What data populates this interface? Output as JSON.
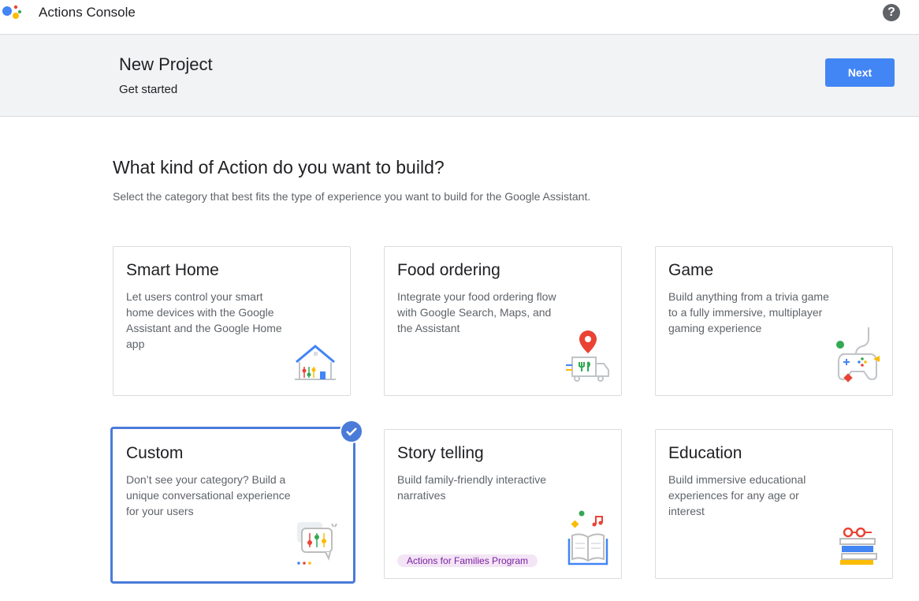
{
  "app": {
    "title": "Actions Console",
    "logo_icon": "google-assistant-logo-icon",
    "help_icon": "help-icon",
    "logo_colors": [
      "#4285f4",
      "#ea4335",
      "#fbbc05",
      "#34a853"
    ]
  },
  "header": {
    "title": "New Project",
    "subtitle": "Get started",
    "next_label": "Next"
  },
  "main": {
    "heading": "What kind of Action do you want to build?",
    "subheading": "Select the category that best fits the type of experience you want to build for the Google Assistant."
  },
  "cards": [
    {
      "title": "Smart Home",
      "description": "Let users control your smart home devices with the Google Assistant and the Google Home app",
      "icon": "smart-home-icon",
      "selected": false
    },
    {
      "title": "Food ordering",
      "description": "Integrate your food ordering flow with Google Search, Maps, and the Assistant",
      "icon": "food-truck-icon",
      "selected": false
    },
    {
      "title": "Game",
      "description": "Build anything from a trivia game to a fully immersive, multiplayer gaming experience",
      "icon": "game-controller-icon",
      "selected": false
    },
    {
      "title": "Custom",
      "description": "Don’t see your category? Build a unique conversational experience for your users",
      "icon": "custom-chat-icon",
      "selected": true
    },
    {
      "title": "Story telling",
      "description": "Build family-friendly interactive narratives",
      "icon": "storybook-icon",
      "selected": false,
      "badge": "Actions for Families Program"
    },
    {
      "title": "Education",
      "description": "Build immersive educational experiences for any age or interest",
      "icon": "books-glasses-icon",
      "selected": false
    }
  ],
  "colors": {
    "accent": "#4285f4",
    "selected_border": "#4a7bd8",
    "badge_bg": "#f3e5f5",
    "badge_text": "#7b1fa2"
  }
}
